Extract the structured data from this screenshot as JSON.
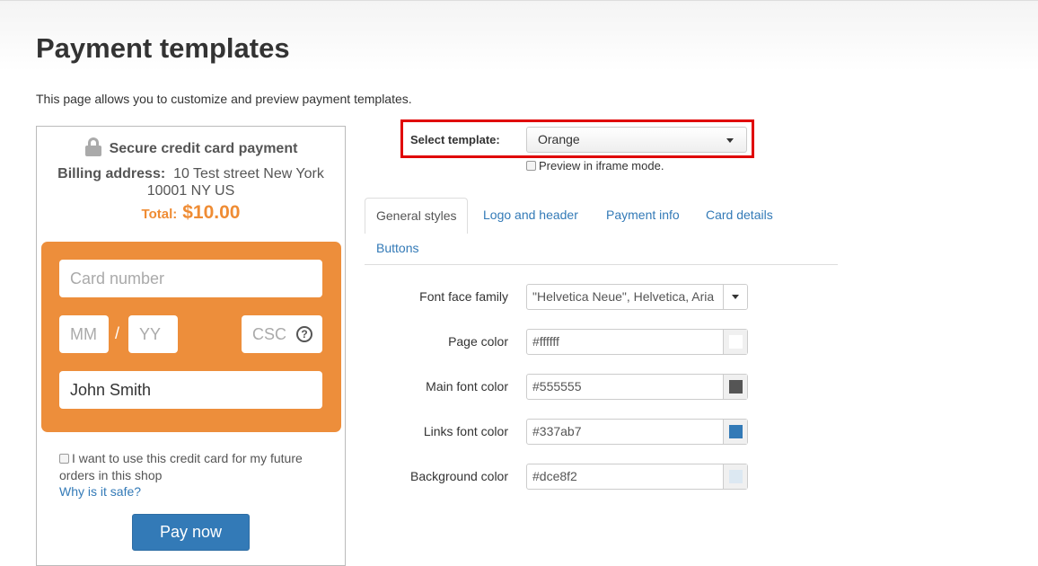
{
  "page": {
    "title": "Payment templates",
    "description": "This page allows you to customize and preview payment templates."
  },
  "preview": {
    "secure_title": "Secure credit card payment",
    "billing_label": "Billing address:",
    "billing_address": "10 Test street New York 10001 NY US",
    "total_label": "Total:",
    "total_amount": "$10.00",
    "card_number_placeholder": "Card number",
    "mm_placeholder": "MM",
    "slash": "/",
    "yy_placeholder": "YY",
    "csc_placeholder": "CSC",
    "help_symbol": "?",
    "name_value": "John Smith",
    "remember_text": "I want to use this credit card for my future orders in this shop",
    "why_safe_link": "Why is it safe?",
    "pay_button": "Pay now",
    "accent_color": "#ef8c34"
  },
  "template_selector": {
    "label": "Select template:",
    "selected": "Orange",
    "iframe_option": "Preview in iframe mode."
  },
  "tabs": [
    {
      "label": "General styles",
      "active": true
    },
    {
      "label": "Logo and header",
      "active": false
    },
    {
      "label": "Payment info",
      "active": false
    },
    {
      "label": "Card details",
      "active": false
    },
    {
      "label": "Buttons",
      "active": false
    }
  ],
  "general_styles": {
    "font_face_label": "Font face family",
    "font_face_value": "\"Helvetica Neue\", Helvetica, Aria",
    "fields": [
      {
        "label": "Page color",
        "value": "#ffffff",
        "swatch": "#ffffff"
      },
      {
        "label": "Main font color",
        "value": "#555555",
        "swatch": "#555555"
      },
      {
        "label": "Links font color",
        "value": "#337ab7",
        "swatch": "#337ab7"
      },
      {
        "label": "Background color",
        "value": "#dce8f2",
        "swatch": "#dce8f2"
      }
    ]
  }
}
